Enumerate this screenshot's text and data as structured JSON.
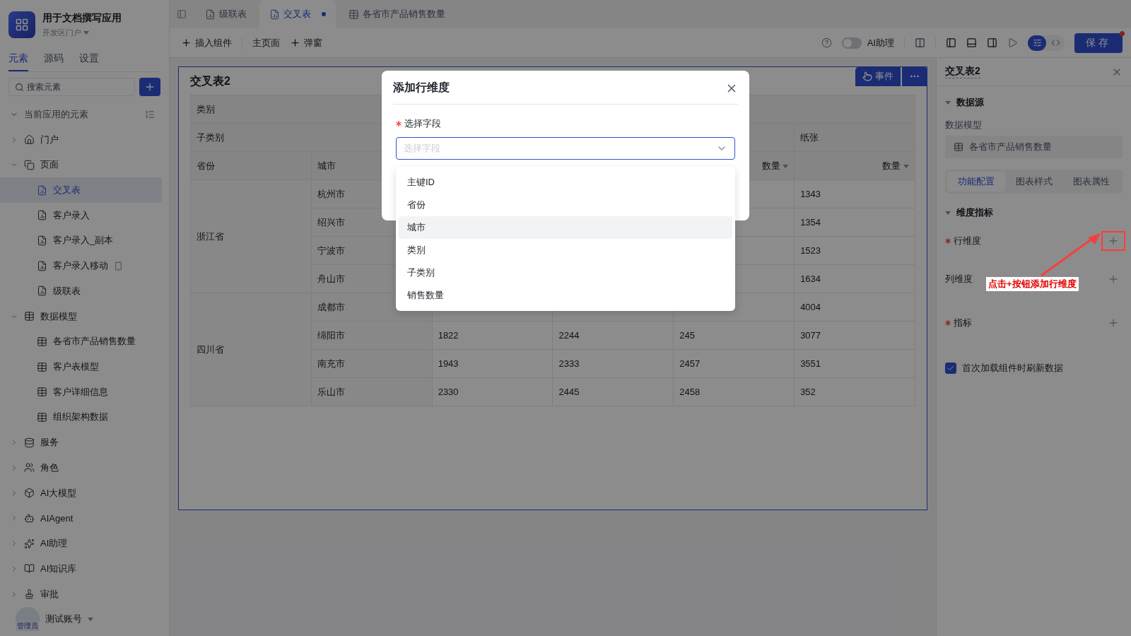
{
  "app": {
    "name": "用于文档撰写应用",
    "portal": "开发区门户"
  },
  "sidebar_tabs": [
    {
      "label": "元素",
      "selected": true
    },
    {
      "label": "源码",
      "selected": false
    },
    {
      "label": "设置",
      "selected": false
    }
  ],
  "search": {
    "placeholder": "搜索元素"
  },
  "tree": {
    "label": "当前应用的元素",
    "expanded": true,
    "items": [
      {
        "label": "门户",
        "kind": "portal",
        "expanded": false,
        "selected": false
      },
      {
        "label": "页面",
        "kind": "pages",
        "expanded": true,
        "selected": false,
        "children": [
          {
            "label": "交叉表",
            "kind": "page",
            "selected": true,
            "mobile": false
          },
          {
            "label": "客户录入",
            "kind": "page",
            "selected": false,
            "mobile": false
          },
          {
            "label": "客户录入_副本",
            "kind": "page",
            "selected": false,
            "mobile": false
          },
          {
            "label": "客户录入移动",
            "kind": "page",
            "selected": false,
            "mobile": true
          },
          {
            "label": "级联表",
            "kind": "page",
            "selected": false,
            "mobile": false
          }
        ]
      },
      {
        "label": "数据模型",
        "kind": "models",
        "expanded": true,
        "selected": false,
        "children": [
          {
            "label": "各省市产品销售数量",
            "kind": "model",
            "selected": false,
            "mobile": false
          },
          {
            "label": "客户表模型",
            "kind": "model",
            "selected": false,
            "mobile": false
          },
          {
            "label": "客户详细信息",
            "kind": "model",
            "selected": false,
            "mobile": false
          },
          {
            "label": "组织架构数据",
            "kind": "model",
            "selected": false,
            "mobile": false
          }
        ]
      },
      {
        "label": "服务",
        "kind": "service",
        "expanded": false,
        "selected": false
      },
      {
        "label": "角色",
        "kind": "role",
        "expanded": false,
        "selected": false
      },
      {
        "label": "AI大模型",
        "kind": "llm",
        "expanded": false,
        "selected": false
      },
      {
        "label": "AIAgent",
        "kind": "agent",
        "expanded": false,
        "selected": false
      },
      {
        "label": "AI助理",
        "kind": "assistant",
        "expanded": false,
        "selected": false
      },
      {
        "label": "AI知识库",
        "kind": "knowledge",
        "expanded": false,
        "selected": false
      },
      {
        "label": "审批",
        "kind": "approval",
        "expanded": false,
        "selected": false
      }
    ]
  },
  "user": {
    "name": "测试账号",
    "role": "管理员"
  },
  "tabs": [
    {
      "label": "级联表",
      "selected": false,
      "unsaved": false,
      "kind": "page"
    },
    {
      "label": "交叉表",
      "selected": true,
      "unsaved": true,
      "kind": "page"
    },
    {
      "label": "各省市产品销售数量",
      "selected": false,
      "unsaved": false,
      "kind": "model"
    }
  ],
  "toolbar": {
    "insert": "插入组件",
    "home": "主页面",
    "popup": "弹窗",
    "assistant": {
      "label": "AI助理",
      "on": false
    },
    "save": "保存",
    "mode": [
      {
        "kind": "settings",
        "selected": true
      },
      {
        "kind": "code",
        "selected": false
      }
    ]
  },
  "canvas": {
    "title": "交叉表2",
    "event_button": "事件",
    "table": {
      "category_label": "类别",
      "subcategory_label": "子类别",
      "subcategories": [
        "纸张"
      ],
      "row_headers": [
        "省份",
        "城市"
      ],
      "measure_headers": [
        "数量",
        "数量"
      ],
      "provinces": [
        {
          "name": "浙江省",
          "cities": [
            {
              "name": "杭州市",
              "values": [
                "1343"
              ]
            },
            {
              "name": "绍兴市",
              "values": [
                "1354"
              ]
            },
            {
              "name": "宁波市",
              "values": [
                "1523"
              ]
            },
            {
              "name": "舟山市",
              "values": [
                "1634"
              ]
            }
          ]
        },
        {
          "name": "四川省",
          "cities": [
            {
              "name": "成都市",
              "values": [
                "4004"
              ]
            },
            {
              "name": "绵阳市",
              "values": [
                "1822",
                "2244",
                "245",
                "3077"
              ]
            },
            {
              "name": "南充市",
              "values": [
                "1943",
                "2333",
                "2457",
                "3551"
              ]
            },
            {
              "name": "乐山市",
              "values": [
                "2330",
                "2445",
                "2458",
                "352"
              ]
            }
          ]
        }
      ]
    }
  },
  "modal": {
    "title": "添加行维度",
    "field_label": "选择字段",
    "required": true,
    "placeholder": "选择字段",
    "options": [
      {
        "label": "主键ID",
        "highlighted": false
      },
      {
        "label": "省份",
        "highlighted": false
      },
      {
        "label": "城市",
        "highlighted": true
      },
      {
        "label": "类别",
        "highlighted": false
      },
      {
        "label": "子类别",
        "highlighted": false
      },
      {
        "label": "销售数量",
        "highlighted": false
      }
    ]
  },
  "panel": {
    "title": "交叉表2",
    "datasource": {
      "title": "数据源",
      "expanded": true,
      "model_label": "数据模型",
      "model": "各省市产品销售数量"
    },
    "tabs": [
      {
        "label": "功能配置",
        "selected": true
      },
      {
        "label": "图表样式",
        "selected": false
      },
      {
        "label": "图表属性",
        "selected": false
      }
    ],
    "dimensions": {
      "title": "维度指标",
      "expanded": true,
      "rows": [
        {
          "label": "行维度",
          "required": true,
          "highlighted": true
        },
        {
          "label": "列维度",
          "required": false,
          "highlighted": false
        },
        {
          "label": "指标",
          "required": true,
          "highlighted": false
        }
      ]
    },
    "refresh": {
      "label": "首次加载组件时刷新数据",
      "checked": true
    }
  },
  "annotation": {
    "text": "点击+按钮添加行维度"
  }
}
